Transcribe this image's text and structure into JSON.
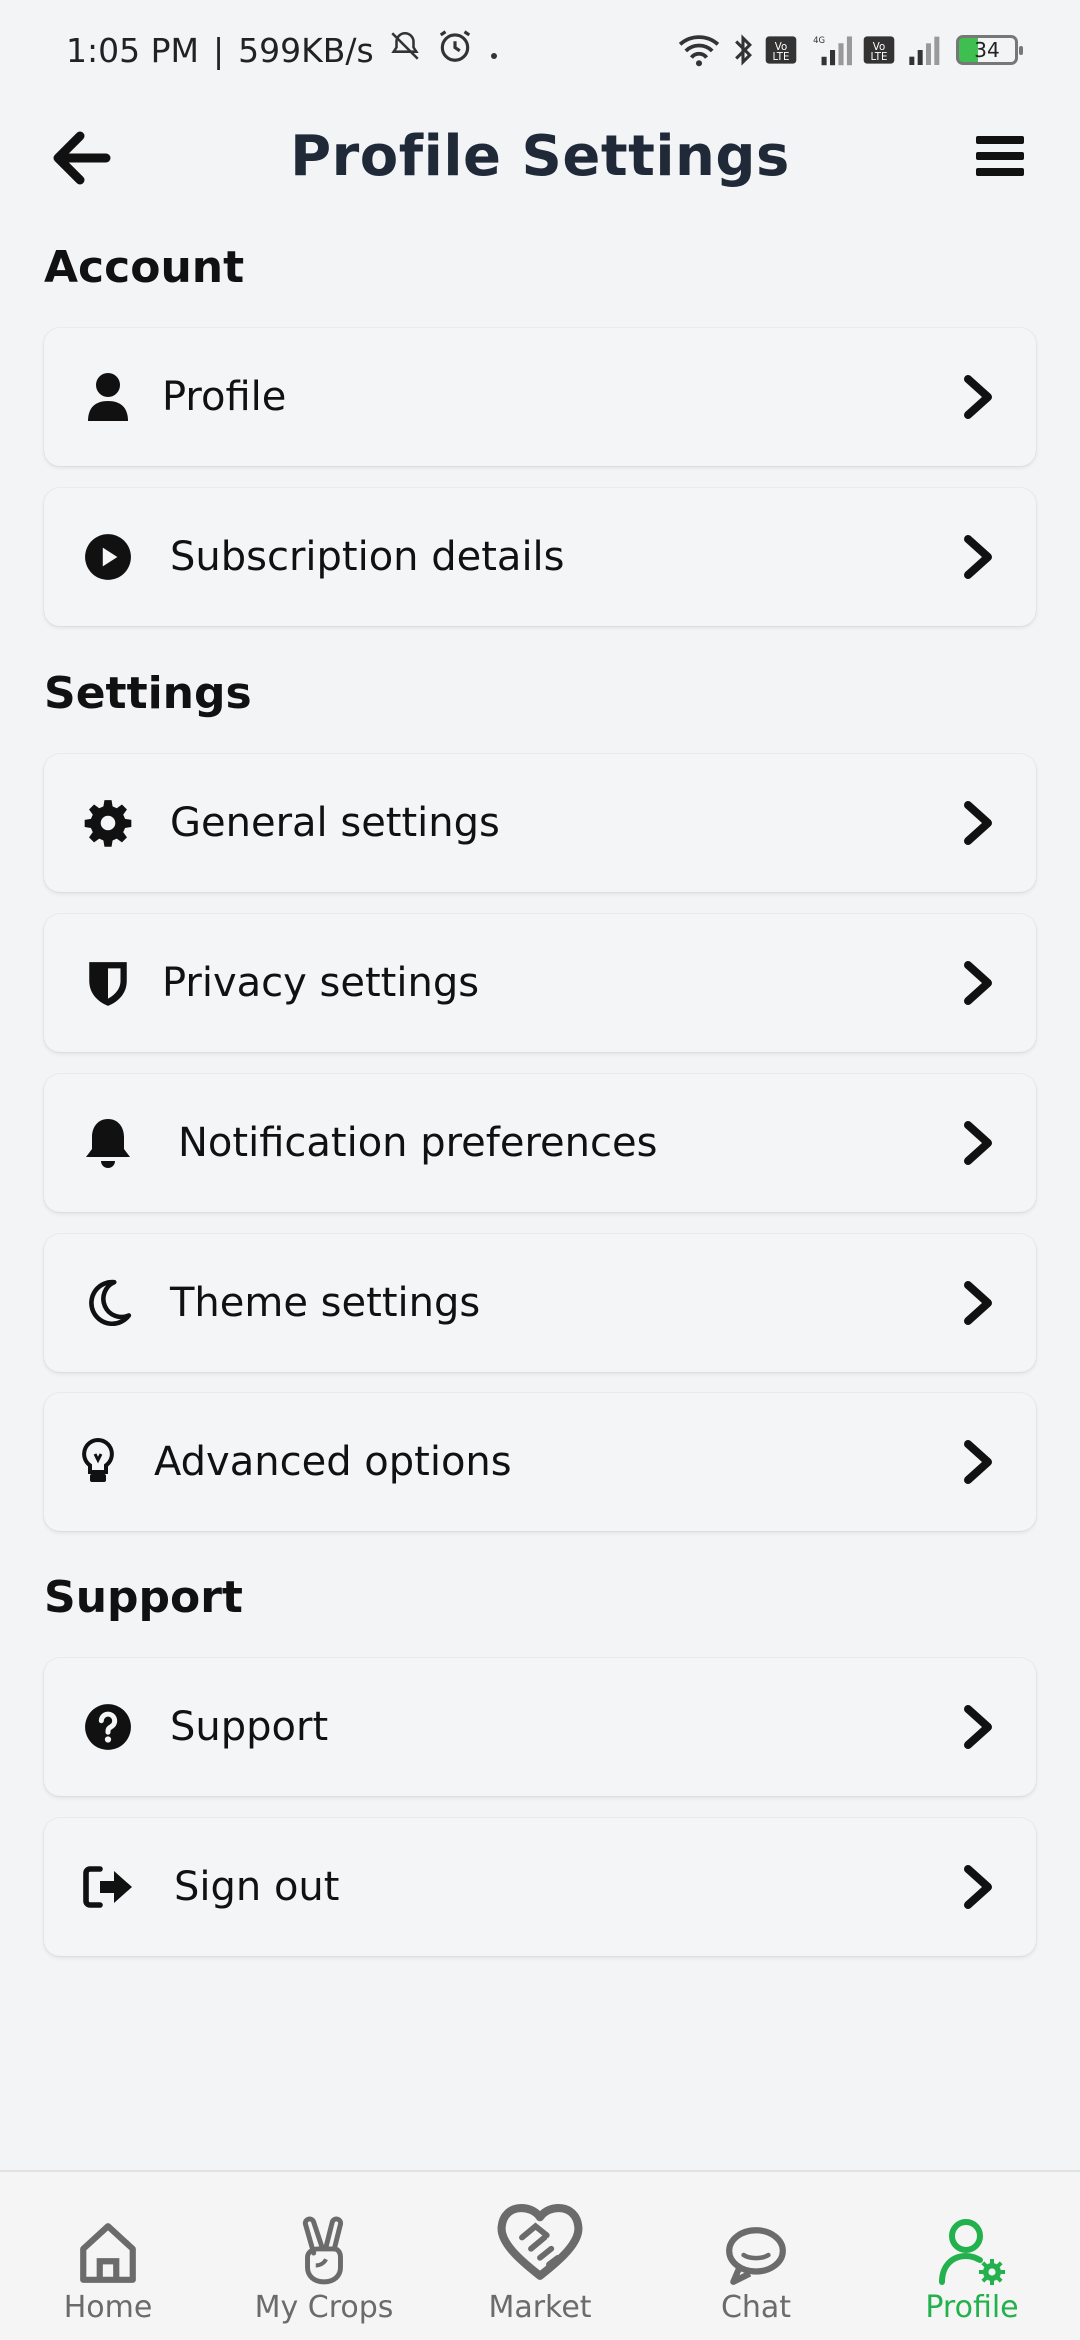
{
  "status_bar": {
    "time": "1:05 PM",
    "speed": "599KB/s",
    "battery": "34"
  },
  "header": {
    "title": "Profile Settings"
  },
  "sections": [
    {
      "title": "Account"
    },
    {
      "title": "Settings"
    },
    {
      "title": "Support"
    }
  ],
  "items": [
    {
      "label": "Profile",
      "icon": "person-icon"
    },
    {
      "label": "Subscription details",
      "icon": "play-circle-icon"
    },
    {
      "label": "General settings",
      "icon": "gear-icon"
    },
    {
      "label": "Privacy settings",
      "icon": "shield-icon"
    },
    {
      "label": "Notification preferences",
      "icon": "bell-icon"
    },
    {
      "label": "Theme settings",
      "icon": "moon-icon"
    },
    {
      "label": "Advanced options",
      "icon": "lightbulb-icon"
    },
    {
      "label": "Support",
      "icon": "question-circle-icon"
    },
    {
      "label": "Sign out",
      "icon": "sign-out-icon"
    }
  ],
  "bottom_nav": [
    {
      "label": "Home",
      "icon": "home-icon"
    },
    {
      "label": "My Crops",
      "icon": "peace-hand-icon"
    },
    {
      "label": "Market",
      "icon": "handshake-heart-icon"
    },
    {
      "label": "Chat",
      "icon": "chat-bubble-icon"
    },
    {
      "label": "Profile",
      "icon": "user-gear-icon",
      "active": true
    }
  ],
  "colors": {
    "background": "#f3f4f6",
    "active": "#22b14c",
    "inactive": "#6b6b6b"
  }
}
